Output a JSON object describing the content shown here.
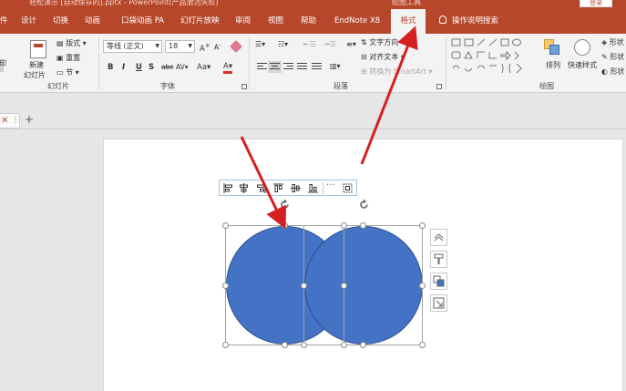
{
  "title_bar": {
    "document_title": "轻松演示 [自动保存的].pptx - PowerPoint(产品激活失败)",
    "context_tools": "绘图工具",
    "login_label": "登录"
  },
  "tabs": [
    {
      "label": "件"
    },
    {
      "label": "设计"
    },
    {
      "label": "切换"
    },
    {
      "label": "动画"
    },
    {
      "label": "口袋动画 PA"
    },
    {
      "label": "幻灯片放映"
    },
    {
      "label": "审阅"
    },
    {
      "label": "视图"
    },
    {
      "label": "帮助"
    },
    {
      "label": "EndNote X8"
    },
    {
      "label": "格式"
    }
  ],
  "search_label": "操作说明搜索",
  "ribbon": {
    "slides": {
      "new_slide": "新建",
      "new_slide_2": "幻灯片",
      "layout": "版式",
      "reset": "重置",
      "section": "节",
      "group_label": "幻灯片"
    },
    "font": {
      "font_name": "等线 (正文)",
      "font_size": "18",
      "bold": "B",
      "italic": "I",
      "underline": "U",
      "strike": "S",
      "shadow": "abc",
      "spacing": "AV",
      "case": "Aa",
      "color": "A",
      "grow": "A",
      "shrink": "A",
      "group_label": "字体"
    },
    "paragraph": {
      "text_direction": "文字方向",
      "align_text": "对齐文本",
      "smartart": "转换为 SmartArt",
      "group_label": "段落"
    },
    "drawing": {
      "arrange": "排列",
      "quick_styles": "快速样式",
      "fill": "形状",
      "outline": "形状",
      "effects": "形状",
      "group_label": "绘图"
    }
  },
  "colors": {
    "accent": "#b7472a",
    "shape_fill": "#4472c4",
    "arrow": "#d62020"
  }
}
